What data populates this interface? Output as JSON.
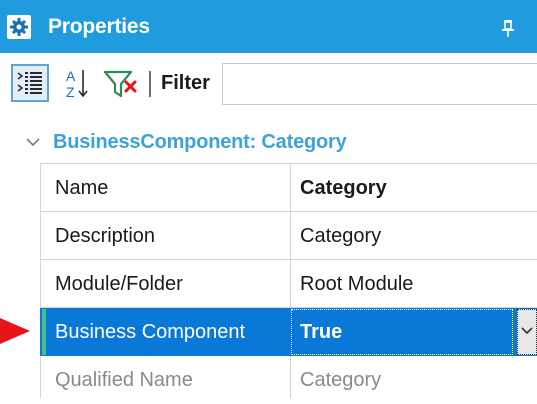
{
  "panel": {
    "title": "Properties",
    "title_icon": "gear-icon",
    "pin_icon": "pin-icon"
  },
  "toolbar": {
    "categorized_icon": "categorized-view-icon",
    "alphabetical_icon": "sort-alphabetical-icon",
    "filter_icon": "filter-icon",
    "filter_label": "Filter",
    "filter_value": "",
    "filter_placeholder": ""
  },
  "group": {
    "title": "BusinessComponent: Category",
    "expanded": true
  },
  "properties": [
    {
      "name": "Name",
      "value": "Category",
      "bold_value": true
    },
    {
      "name": "Description",
      "value": "Category",
      "bold_value": false
    },
    {
      "name": "Module/Folder",
      "value": "Root Module",
      "bold_value": false
    },
    {
      "name": "Business Component",
      "value": "True",
      "bold_value": true,
      "selected": true,
      "has_dropdown": true
    },
    {
      "name": "Qualified Name",
      "value": "Category",
      "bold_value": false,
      "disabled": true
    }
  ],
  "colors": {
    "title_bar": "#1f9bde",
    "selection": "#0a78d7",
    "group_title": "#3ea2d8",
    "annotation_arrow": "#e8141c",
    "selection_marker": "#46c08f"
  }
}
